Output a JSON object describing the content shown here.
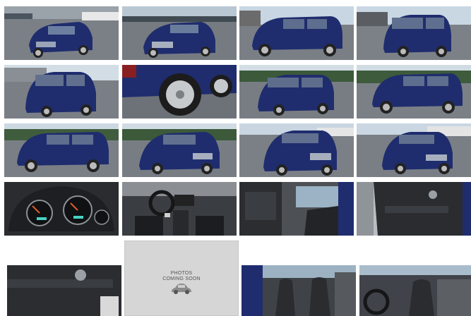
{
  "gallery": {
    "placeholder": {
      "line1": "PHOTOS",
      "line2": "COMING SOON"
    },
    "colors": {
      "car_body": "#1f2d6e",
      "asphalt": "#6f747a",
      "sky": "#cfe0ee",
      "interior": "#2a2c30"
    }
  }
}
